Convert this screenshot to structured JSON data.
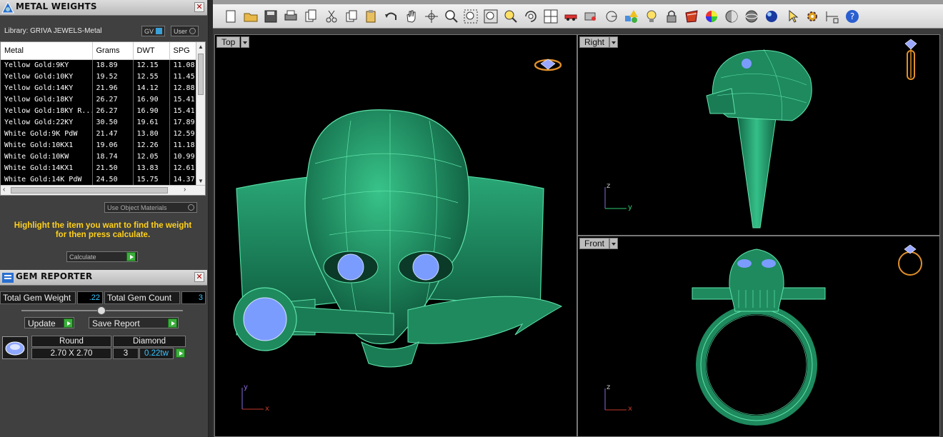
{
  "metal_panel": {
    "title": "METAL WEIGHTS",
    "library": "Library: GRIVA JEWELS-Metal",
    "toggle_gv": "GV",
    "toggle_user": "User",
    "columns": [
      "Metal",
      "Grams",
      "DWT",
      "SPG"
    ],
    "rows": [
      [
        "Yellow Gold:9KY",
        "18.89",
        "12.15",
        "11.08"
      ],
      [
        "Yellow Gold:10KY",
        "19.52",
        "12.55",
        "11.45"
      ],
      [
        "Yellow Gold:14KY",
        "21.96",
        "14.12",
        "12.88"
      ],
      [
        "Yellow Gold:18KY",
        "26.27",
        "16.90",
        "15.41"
      ],
      [
        "Yellow Gold:18KY R...",
        "26.27",
        "16.90",
        "15.41"
      ],
      [
        "Yellow Gold:22KY",
        "30.50",
        "19.61",
        "17.89"
      ],
      [
        "White Gold:9K PdW",
        "21.47",
        "13.80",
        "12.59"
      ],
      [
        "White Gold:10KX1",
        "19.06",
        "12.26",
        "11.18"
      ],
      [
        "White Gold:10KW",
        "18.74",
        "12.05",
        "10.99"
      ],
      [
        "White Gold:14KX1",
        "21.50",
        "13.83",
        "12.61"
      ],
      [
        "White Gold:14K PdW",
        "24.50",
        "15.75",
        "14.37"
      ]
    ],
    "use_object_materials": "Use Object Materials",
    "hint_line1": "Highlight the item you want to find the weight",
    "hint_line2": "for then press calculate.",
    "calculate": "Calculate"
  },
  "gem_panel": {
    "title": "GEM REPORTER",
    "total_weight_label": "Total Gem Weight",
    "total_weight_value": ".22",
    "total_count_label": "Total Gem Count",
    "total_count_value": "3",
    "update": "Update",
    "save_report": "Save Report",
    "gem": {
      "shape": "Round",
      "type": "Diamond",
      "size": "2.70 X 2.70",
      "count": "3",
      "weight": "0.22tw"
    }
  },
  "toolbar": {
    "icons": [
      "new-file-icon",
      "open-folder-icon",
      "save-icon",
      "print-icon",
      "copy-file-icon",
      "cut-icon",
      "copy-icon",
      "paste-icon",
      "undo-icon",
      "pan-hand-icon",
      "move-icon",
      "zoom-in-icon",
      "zoom-window-icon",
      "zoom-extents-icon",
      "zoom-selected-icon",
      "rotate-view-icon",
      "four-viewports-icon",
      "car-icon",
      "render-settings-icon",
      "osnap-icon",
      "shapes-icon",
      "light-bulb-icon",
      "lock-icon",
      "material-icon",
      "color-wheel-icon",
      "shade-icon",
      "ghosted-icon",
      "rendered-icon",
      "select-arrow-icon",
      "settings-gear-icon",
      "dimension-icon",
      "help-icon"
    ]
  },
  "viewports": {
    "top": {
      "label": "Top",
      "axis_y": "y",
      "axis_x": "x"
    },
    "right": {
      "label": "Right",
      "axis_y": "z",
      "axis_x": "y"
    },
    "front": {
      "label": "Front",
      "axis_y": "z",
      "axis_x": "x"
    }
  },
  "colors": {
    "model_green": "#1f8f62",
    "gem_blue": "#7b9cff",
    "hint_yellow": "#ffd11a",
    "value_cyan": "#39c6ff"
  }
}
